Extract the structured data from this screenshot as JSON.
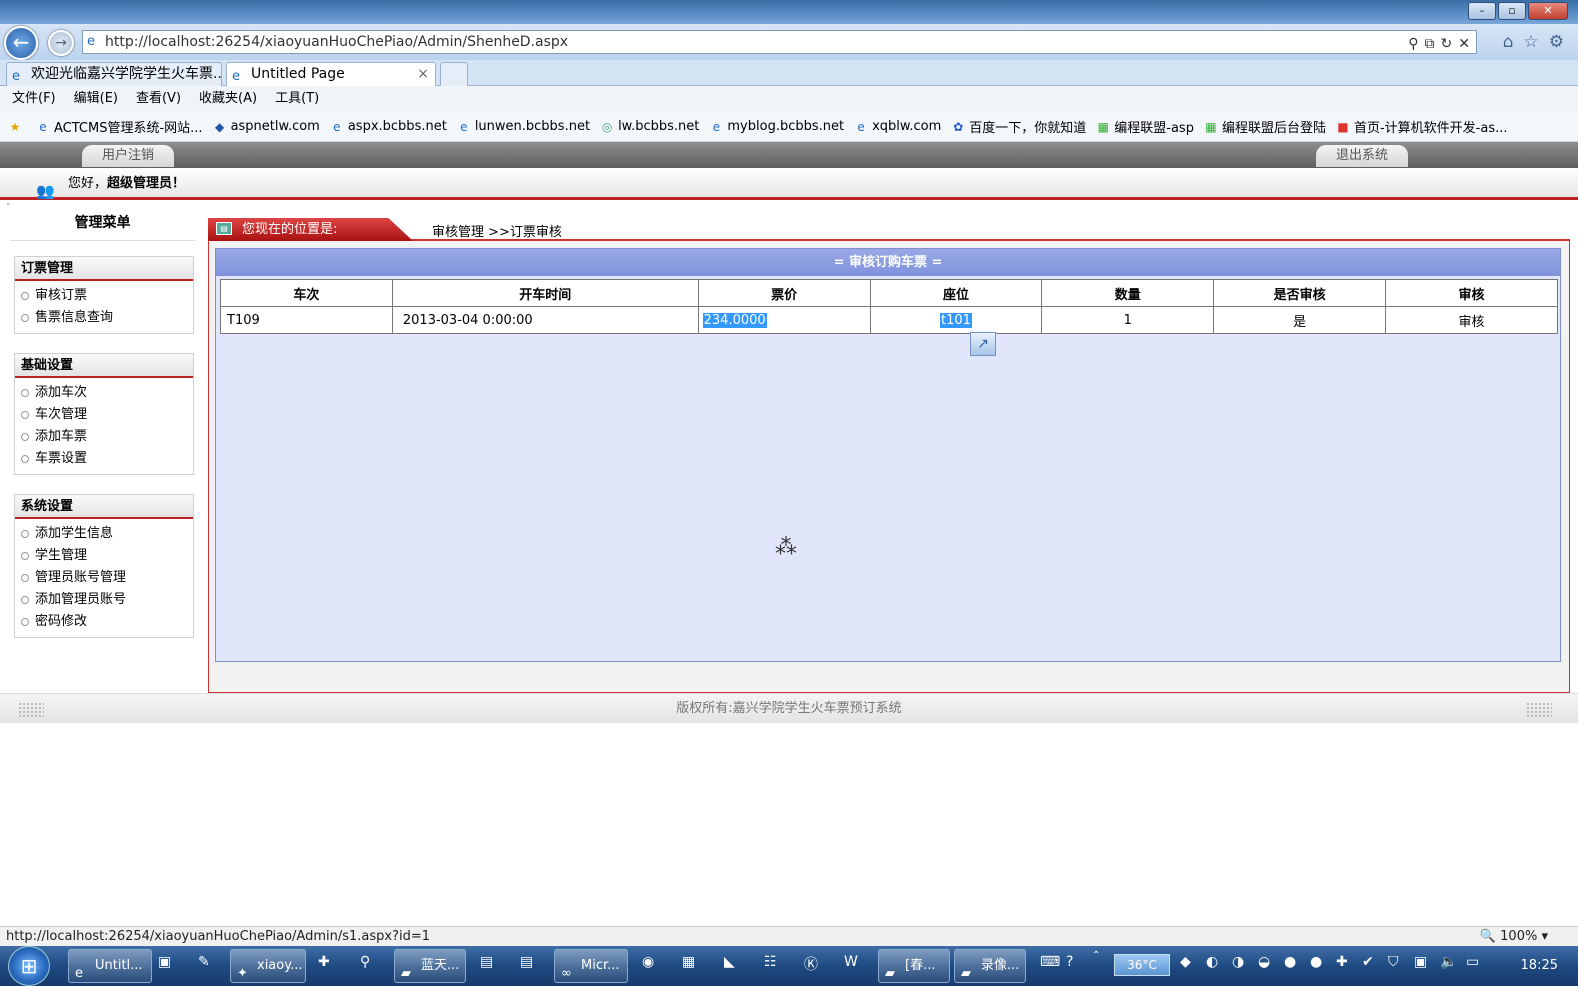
{
  "browser": {
    "address": "http://localhost:26254/xiaoyuanHuoChePiao/Admin/ShenheD.aspx",
    "address_host": "localhost",
    "tabs": [
      {
        "label": "欢迎光临嘉兴学院学生火车票..."
      },
      {
        "label": "Untitled Page"
      }
    ],
    "menu": [
      "文件(F)",
      "编辑(E)",
      "查看(V)",
      "收藏夹(A)",
      "工具(T)"
    ],
    "favorites": [
      "ACTCMS管理系统-网站...",
      "aspnetlw.com",
      "aspx.bcbbs.net",
      "lunwen.bcbbs.net",
      "lw.bcbbs.net",
      "myblog.bcbbs.net",
      "xqblw.com",
      "百度一下，你就知道",
      "编程联盟-asp",
      "编程联盟后台登陆",
      "首页-计算机软件开发-as..."
    ],
    "status_url": "http://localhost:26254/xiaoyuanHuoChePiao/Admin/s1.aspx?id=1",
    "zoom": "100%"
  },
  "top": {
    "logout_user": "用户注销",
    "exit_system": "退出系统",
    "greeting_prefix": "您好，",
    "greeting_name": "超级管理员！"
  },
  "sidebar": {
    "title": "管理菜单",
    "groups": [
      {
        "title": "订票管理",
        "items": [
          "审核订票",
          "售票信息查询"
        ]
      },
      {
        "title": "基础设置",
        "items": [
          "添加车次",
          "车次管理",
          "添加车票",
          "车票设置"
        ]
      },
      {
        "title": "系统设置",
        "items": [
          "添加学生信息",
          "学生管理",
          "管理员账号管理",
          "添加管理员账号",
          "密码修改"
        ]
      }
    ]
  },
  "location": {
    "label": "您现在的位置是:",
    "crumb": "审核管理 >>订票审核"
  },
  "panel": {
    "title": "= 审核订购车票 =",
    "columns": [
      "车次",
      "开车时间",
      "票价",
      "座位",
      "数量",
      "是否审核",
      "审核"
    ],
    "rows": [
      {
        "train": "T109",
        "time": "2013-03-04 0:00:00",
        "price": "234.0000",
        "seat": "t101",
        "qty": "1",
        "audited": "是",
        "action": "审核"
      }
    ]
  },
  "footer": {
    "text": "版权所有:嘉兴学院学生火车票预订系统"
  },
  "taskbar": {
    "buttons": [
      "Untitl...",
      "xiaoy...",
      "蓝天...",
      "Micr...",
      "[春...",
      "录像..."
    ],
    "temperature": "36°C",
    "clock": "18:25"
  }
}
